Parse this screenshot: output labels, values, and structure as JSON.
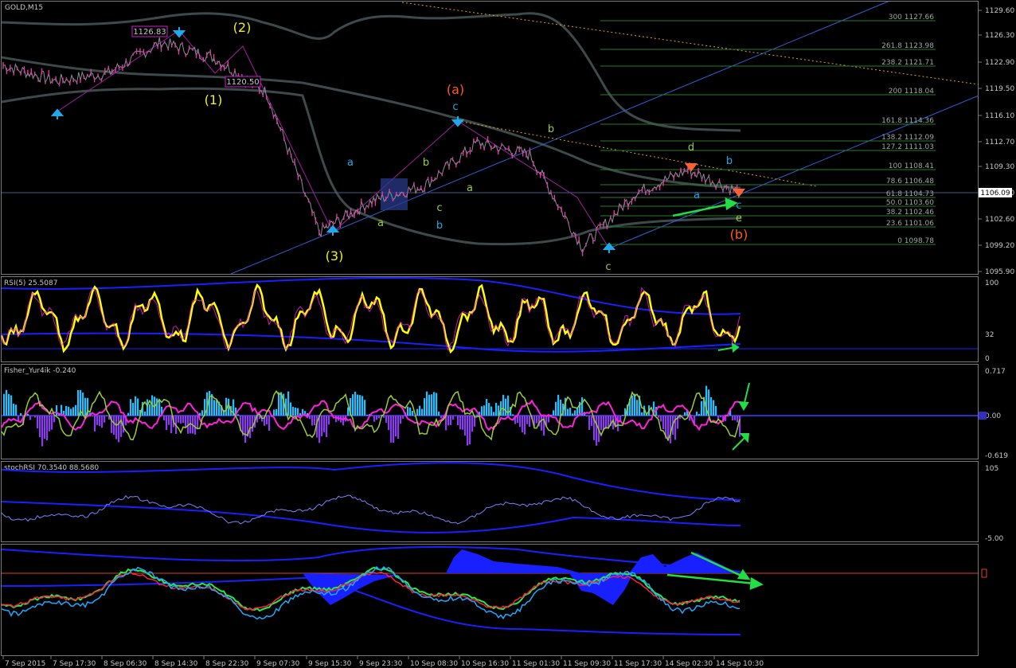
{
  "colors": {
    "background": "#000000",
    "grid": "#2a2a2a",
    "candle": "#d83fa0",
    "price_line": "#8b8f98",
    "bands": "#3d4a4a",
    "trend": "#2f5fd0",
    "fib": "#2d7a2d",
    "fib_text": "#9fa7a0",
    "yellow": "#f0f020",
    "green_arrow": "#22dd44",
    "orange": "#ff5a1a",
    "cyan": "#20a8e8",
    "lime": "#9acd32",
    "magenta": "#ff20e0",
    "rsi_yellow": "#ffff00",
    "blue_line": "#1820ff",
    "fisher_hist_pos": "#20c0ff",
    "fisher_hist_neg": "#8a3cf0"
  },
  "main_panel": {
    "title": "GOLD,M15",
    "price_marker": "1106.09",
    "y_ticks": [
      "1129.60",
      "1126.30",
      "1122.90",
      "1119.50",
      "1116.10",
      "1112.70",
      "1109.30",
      "1106.00",
      "1102.60",
      "1099.20",
      "1095.90"
    ],
    "price_boxes": [
      "1126.83",
      "1120.50"
    ],
    "wave_labels": {
      "w1": "(1)",
      "w2": "(2)",
      "w3": "(3)",
      "wa": "(a)",
      "wb": "(b)",
      "a1": "a",
      "b1": "b",
      "c1": "c",
      "a2": "a",
      "b2": "b",
      "c2": "c",
      "b3": "b",
      "c3": "c",
      "d": "d",
      "a3": "a",
      "b4": "b",
      "c4": "c",
      "e": "e",
      "b5": "b",
      "c5": "c",
      "a4": "a"
    },
    "fib_levels": [
      {
        "ratio": "300",
        "price": "1127.66"
      },
      {
        "ratio": "261.8",
        "price": "1123.98"
      },
      {
        "ratio": "238.2",
        "price": "1121.71"
      },
      {
        "ratio": "200",
        "price": "1118.04"
      },
      {
        "ratio": "161.8",
        "price": "1114.36"
      },
      {
        "ratio": "138.2",
        "price": "1112.09"
      },
      {
        "ratio": "127.2",
        "price": "1111.03"
      },
      {
        "ratio": "100",
        "price": "1108.41"
      },
      {
        "ratio": "78.6",
        "price": "1106.48"
      },
      {
        "ratio": "61.8",
        "price": "1104.73"
      },
      {
        "ratio": "50.0",
        "price": "1103.60"
      },
      {
        "ratio": "38.2",
        "price": "1102.46"
      },
      {
        "ratio": "23.6",
        "price": "1101.06"
      },
      {
        "ratio": "0",
        "price": "1098.78"
      }
    ]
  },
  "rsi_panel": {
    "title": "RSI(5) 25.5087",
    "y_ticks": [
      "100",
      "32",
      "0"
    ]
  },
  "fisher_panel": {
    "title": "Fisher_Yur4ik -0.240",
    "y_ticks": [
      "0.717",
      "0.00",
      "-0.619"
    ]
  },
  "stoch_panel": {
    "title": "stochRSI 70.3540 88.5680",
    "y_ticks": [
      "105",
      "-5.00"
    ]
  },
  "bottom_panel": {
    "title": ""
  },
  "x_axis": [
    "7 Sep 2015",
    "7 Sep 17:30",
    "8 Sep 06:30",
    "8 Sep 14:30",
    "8 Sep 22:30",
    "9 Sep 07:30",
    "9 Sep 15:30",
    "9 Sep 23:30",
    "10 Sep 08:30",
    "10 Sep 16:30",
    "11 Sep 01:30",
    "11 Sep 09:30",
    "11 Sep 17:30",
    "14 Sep 02:30",
    "14 Sep 10:30"
  ],
  "chart_data": {
    "type": "line",
    "title": "GOLD,M15",
    "x": [
      "7 Sep 2015",
      "7 Sep 17:30",
      "8 Sep 06:30",
      "8 Sep 14:30",
      "8 Sep 22:30",
      "9 Sep 07:30",
      "9 Sep 15:30",
      "9 Sep 23:30",
      "10 Sep 08:30",
      "10 Sep 16:30",
      "11 Sep 01:30",
      "11 Sep 09:30",
      "11 Sep 17:30",
      "14 Sep 02:30",
      "14 Sep 10:30"
    ],
    "ylim": [
      1095.9,
      1129.6
    ],
    "series": [
      {
        "name": "",
        "values": [
          1122.5,
          1120.5,
          1121.5,
          1125.5,
          1123.5,
          1119.0,
          1101.0,
          1105.0,
          1107.0,
          1112.5,
          1111.0,
          1099.0,
          1106.0,
          1109.0,
          1106.09
        ]
      }
    ],
    "legend": "none",
    "grid": false
  }
}
